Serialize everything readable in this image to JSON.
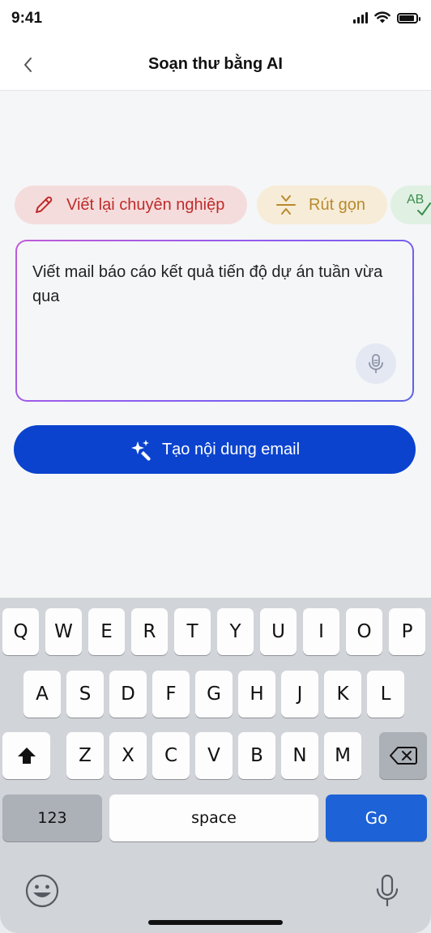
{
  "status": {
    "time": "9:41"
  },
  "header": {
    "title": "Soạn thư bằng AI",
    "back_icon": "chevron-left-icon"
  },
  "chips": [
    {
      "label": "Viết lại chuyên nghiệp",
      "icon": "pencil-icon",
      "color": "#bf2b2b",
      "bg": "#f5dcdc"
    },
    {
      "label": "Rút gọn",
      "icon": "compress-icon",
      "color": "#b98a2e",
      "bg": "#f7ecd7"
    },
    {
      "label": "AB",
      "icon": "spellcheck-icon",
      "color": "#3a8f4d",
      "bg": "#e0f1e3"
    }
  ],
  "prompt": {
    "text": "Viết mail báo cáo kết quả tiến độ dự án tuần vừa qua",
    "mic_icon": "microphone-icon"
  },
  "generate": {
    "label": "Tạo nội dung email",
    "icon": "sparkle-icon",
    "color": "#0b43cf"
  },
  "keyboard": {
    "row1": [
      "Q",
      "W",
      "E",
      "R",
      "T",
      "Y",
      "U",
      "I",
      "O",
      "P"
    ],
    "row2": [
      "A",
      "S",
      "D",
      "F",
      "G",
      "H",
      "J",
      "K",
      "L"
    ],
    "row3": [
      "Z",
      "X",
      "C",
      "V",
      "B",
      "N",
      "M"
    ],
    "numbers_label": "123",
    "space_label": "space",
    "go_label": "Go"
  }
}
